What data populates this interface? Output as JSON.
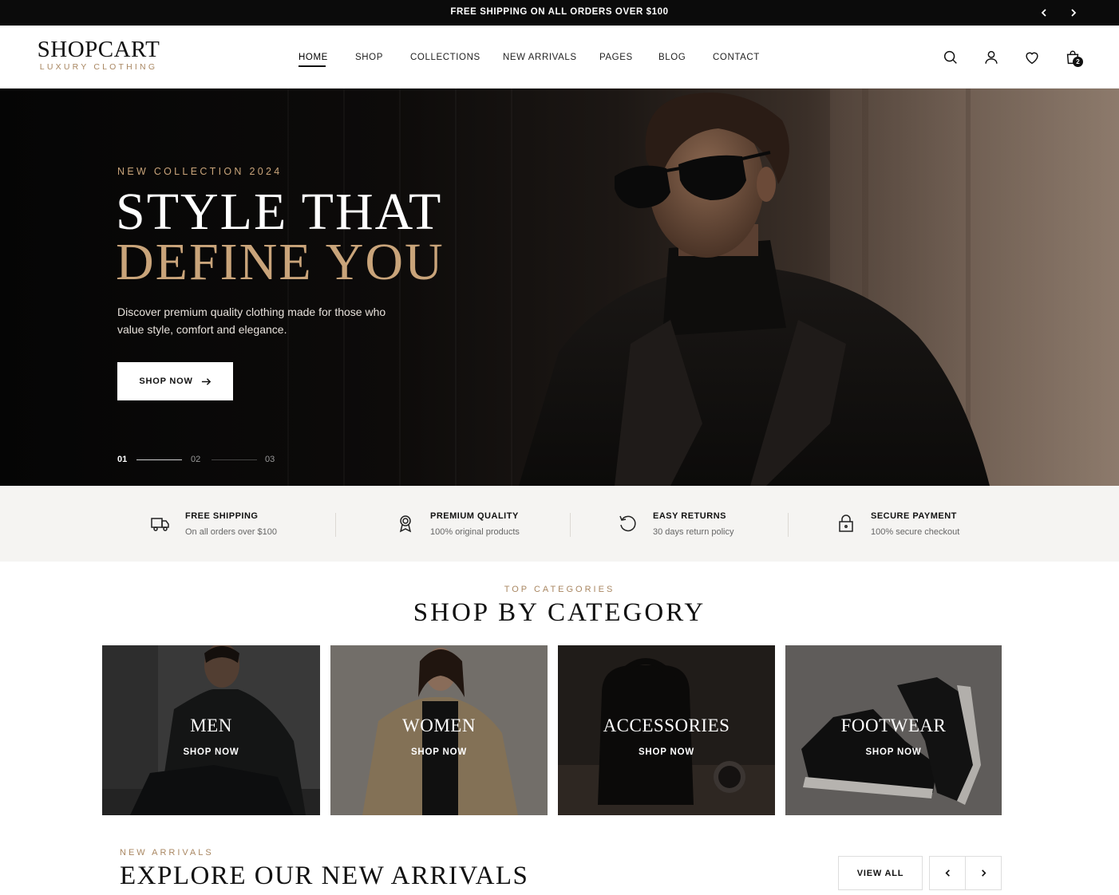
{
  "announcement": {
    "text": "FREE SHIPPING ON ALL ORDERS OVER $100",
    "prev_icon": "chevron-left-icon",
    "next_icon": "chevron-right-icon"
  },
  "header": {
    "logo_name": "SHOPCART",
    "logo_tagline": "LUXURY CLOTHING",
    "nav": [
      {
        "label": "HOME",
        "active": true
      },
      {
        "label": "SHOP"
      },
      {
        "label": "COLLECTIONS"
      },
      {
        "label": "NEW ARRIVALS"
      },
      {
        "label": "PAGES"
      },
      {
        "label": "BLOG"
      },
      {
        "label": "CONTACT"
      }
    ],
    "icons": [
      "search-icon",
      "user-icon",
      "heart-icon",
      "shopping-bag-icon"
    ],
    "cart_count": "2"
  },
  "hero": {
    "eyebrow": "NEW COLLECTION 2024",
    "headline_line1": "STYLE  THAT",
    "headline_line2": "DEFINE  YOU",
    "description": "Discover premium quality clothing made for those who value style, comfort and elegance.",
    "button_label": "SHOP NOW",
    "slides": [
      "01",
      "02",
      "03"
    ],
    "active_slide": 0
  },
  "features": [
    {
      "icon": "truck-icon",
      "title": "FREE SHIPPING",
      "subtitle": "On all orders over $100"
    },
    {
      "icon": "award-icon",
      "title": "PREMIUM QUALITY",
      "subtitle": "100% original products"
    },
    {
      "icon": "returns-icon",
      "title": "EASY RETURNS",
      "subtitle": "30 days return policy"
    },
    {
      "icon": "lock-icon",
      "title": "SECURE PAYMENT",
      "subtitle": "100% secure checkout"
    }
  ],
  "categories": {
    "eyebrow": "TOP CATEGORIES",
    "title": "SHOP BY CATEGORY",
    "items": [
      {
        "name": "MEN",
        "cta": "SHOP NOW"
      },
      {
        "name": "WOMEN",
        "cta": "SHOP NOW"
      },
      {
        "name": "ACCESSORIES",
        "cta": "SHOP NOW"
      },
      {
        "name": "FOOTWEAR",
        "cta": "SHOP NOW"
      }
    ]
  },
  "new_arrivals": {
    "eyebrow": "NEW ARRIVALS",
    "title": "EXPLORE OUR NEW ARRIVALS",
    "view_all": "VIEW ALL"
  },
  "colors": {
    "accent": "#c9a47a",
    "topbar_bg": "#0b0b0b",
    "features_bg": "#f5f4f2"
  }
}
